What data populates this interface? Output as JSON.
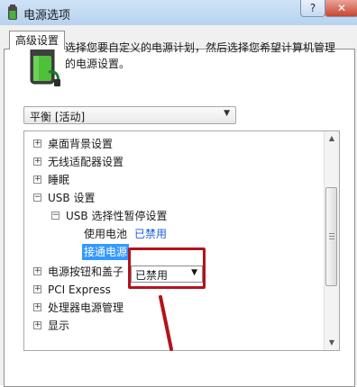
{
  "window": {
    "title": "电源选项",
    "help": "?",
    "close": "✕"
  },
  "tabs": [
    {
      "label": "高级设置"
    }
  ],
  "description": "选择您要自定义的电源计划，然后选择您希望计算机管理的电源设置。",
  "plan_select": {
    "value": "平衡 [活动]"
  },
  "tree": {
    "items": [
      {
        "label": "桌面背景设置",
        "expander": "+"
      },
      {
        "label": "无线适配器设置",
        "expander": "+"
      },
      {
        "label": "睡眠",
        "expander": "+"
      },
      {
        "label": "USB 设置",
        "expander": "−"
      },
      {
        "label": "USB 选择性暂停设置",
        "expander": "−"
      },
      {
        "label": "使用电池",
        "value": "已禁用"
      },
      {
        "label": "接通电源",
        "value": "已禁用"
      },
      {
        "label": "电源按钮和盖子",
        "expander": "+"
      },
      {
        "label": "PCI Express",
        "expander": "+"
      },
      {
        "label": "处理器电源管理",
        "expander": "+"
      },
      {
        "label": "显示",
        "expander": "+"
      }
    ]
  },
  "colors": {
    "annotation": "#b5121b",
    "selection": "#3399ff",
    "link_value": "#1c5fd6"
  },
  "icons": {
    "app": "battery-plug-icon",
    "panel": "battery-icon"
  }
}
